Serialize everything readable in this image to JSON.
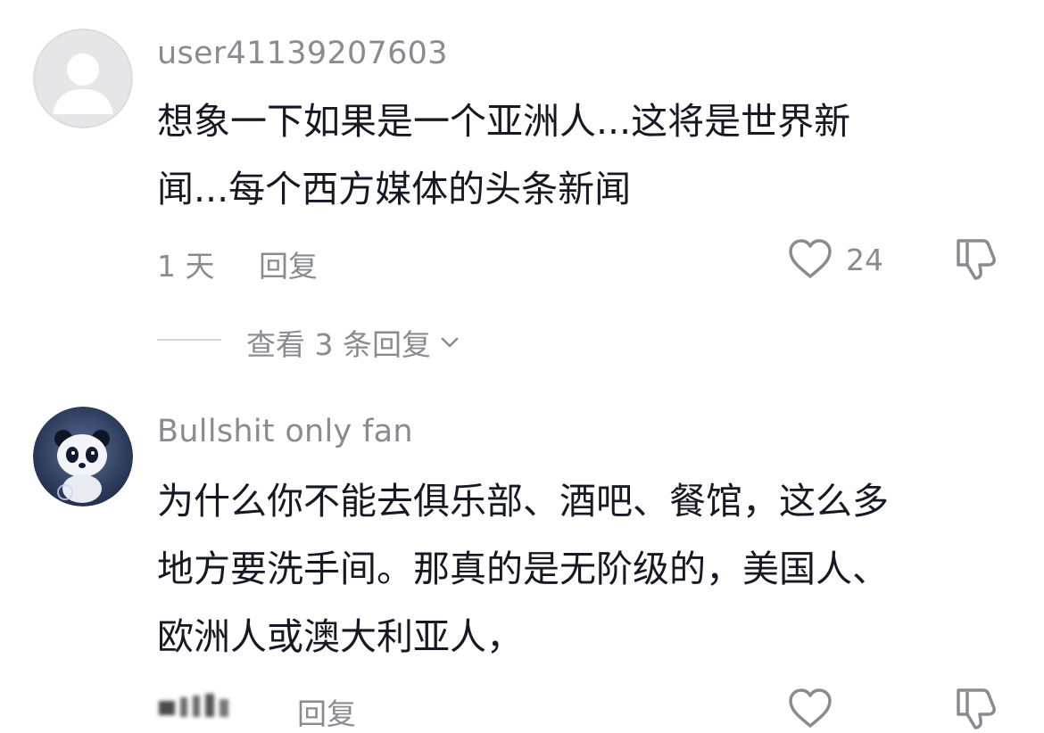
{
  "comments": [
    {
      "username": "user41139207603",
      "text_line1": "想象一下如果是一个亚洲人...这将是世界新",
      "text_line2": "闻...每个西方媒体的头条新闻",
      "time": "1 天",
      "reply_label": "回复",
      "like_count": "24",
      "view_replies": "查看 3 条回复",
      "avatar_icon": "default-user-avatar-icon"
    },
    {
      "username": "Bullshit only fan",
      "text_line1": "为什么你不能去俱乐部、酒吧、餐馆，这么多",
      "text_line2": "地方要洗手间。那真的是无阶级的，美国人、",
      "text_line3": "欧洲人或澳大利亚人，",
      "time": "",
      "reply_label": "回复",
      "avatar_icon": "panda-avatar-icon"
    }
  ],
  "colors": {
    "text": "#161823",
    "secondary": "#8a8b91",
    "divider": "#d6d7da",
    "avatar_default_bg": "#e6e6e8"
  }
}
